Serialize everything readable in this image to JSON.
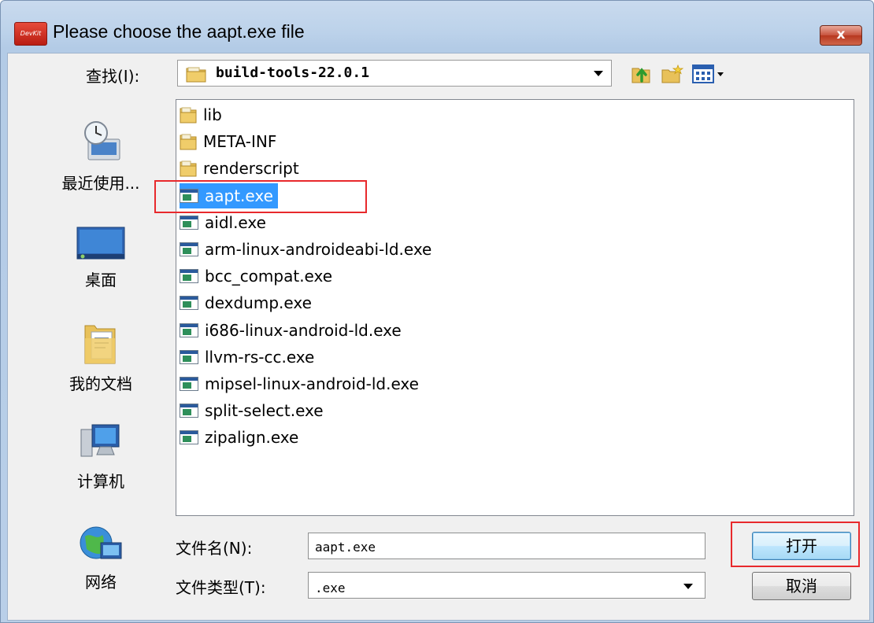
{
  "window": {
    "title": "Please choose the aapt.exe file",
    "app_icon_text": "DevKit",
    "close_label": "x"
  },
  "lookin": {
    "label": "查找(I):",
    "value": "build-tools-22.0.1"
  },
  "toolbar": {
    "icons": [
      "up-folder-icon",
      "new-folder-icon",
      "view-menu-icon"
    ]
  },
  "places": [
    {
      "label": "最近使用...",
      "icon": "recent-items-icon"
    },
    {
      "label": "桌面",
      "icon": "desktop-icon"
    },
    {
      "label": "我的文档",
      "icon": "my-documents-icon"
    },
    {
      "label": "计算机",
      "icon": "computer-icon"
    },
    {
      "label": "网络",
      "icon": "network-icon"
    }
  ],
  "files": [
    {
      "name": "lib",
      "type": "folder"
    },
    {
      "name": "META-INF",
      "type": "folder"
    },
    {
      "name": "renderscript",
      "type": "folder"
    },
    {
      "name": "aapt.exe",
      "type": "exe",
      "selected": true
    },
    {
      "name": "aidl.exe",
      "type": "exe"
    },
    {
      "name": "arm-linux-androideabi-ld.exe",
      "type": "exe"
    },
    {
      "name": "bcc_compat.exe",
      "type": "exe"
    },
    {
      "name": "dexdump.exe",
      "type": "exe"
    },
    {
      "name": "i686-linux-android-ld.exe",
      "type": "exe"
    },
    {
      "name": "llvm-rs-cc.exe",
      "type": "exe"
    },
    {
      "name": "mipsel-linux-android-ld.exe",
      "type": "exe"
    },
    {
      "name": "split-select.exe",
      "type": "exe"
    },
    {
      "name": "zipalign.exe",
      "type": "exe"
    }
  ],
  "filename": {
    "label": "文件名(N):",
    "value": "aapt.exe"
  },
  "filetype": {
    "label": "文件类型(T):",
    "value": ".exe"
  },
  "buttons": {
    "open": "打开",
    "cancel": "取消"
  },
  "colors": {
    "selection": "#3399ff",
    "highlight_box": "#e8292c",
    "folder": "#e8c15a"
  }
}
